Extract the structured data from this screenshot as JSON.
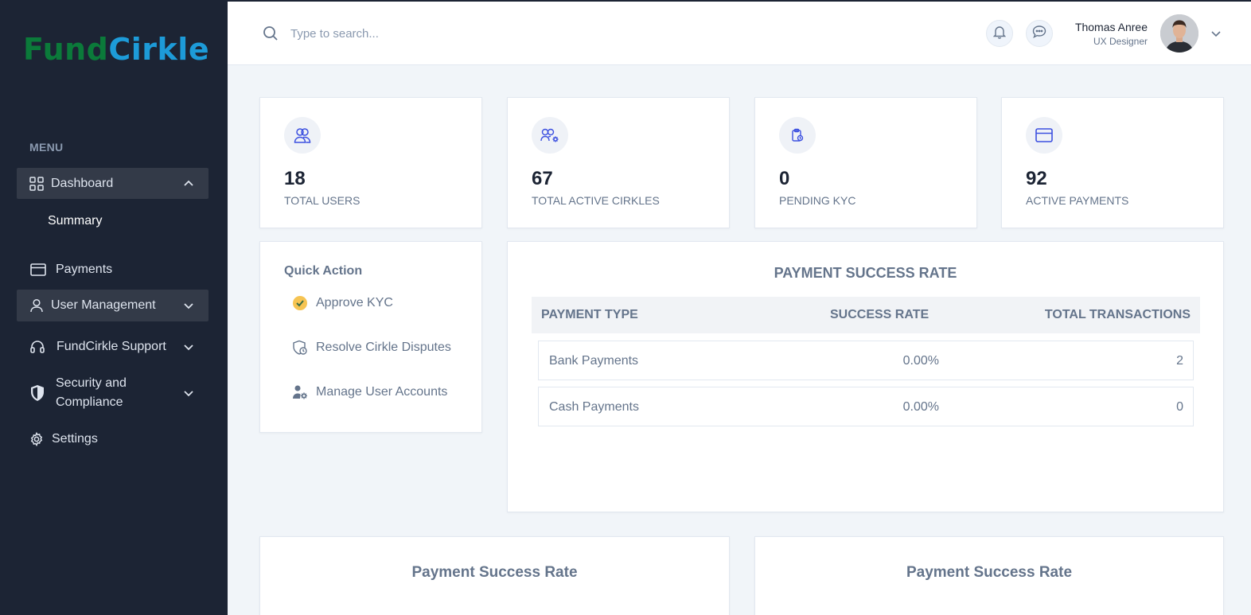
{
  "brand": {
    "part1": "Fund",
    "part2": "Cirkle",
    "color1": "#0b7a3a",
    "color2": "#1d9bd8"
  },
  "sidebar": {
    "menu_label": "MENU",
    "items": [
      {
        "label": "Dashboard",
        "icon": "grid-icon",
        "expanded": true,
        "active": true
      },
      {
        "label": "Summary",
        "sub": true
      },
      {
        "label": "Payments",
        "icon": "credit-card-icon"
      },
      {
        "label": "User Management",
        "icon": "user-icon",
        "active": true
      },
      {
        "label": "FundCirkle Support",
        "icon": "headset-icon"
      },
      {
        "label": "Security and Compliance",
        "icon": "shield-icon"
      },
      {
        "label": "Settings",
        "icon": "gear-icon"
      }
    ]
  },
  "header": {
    "search_placeholder": "Type to search...",
    "user": {
      "name": "Thomas Anree",
      "role": "UX Designer"
    }
  },
  "stats": [
    {
      "value": "18",
      "label": "TOTAL USERS",
      "icon": "users-icon"
    },
    {
      "value": "67",
      "label": "TOTAL ACTIVE CIRKLES",
      "icon": "users-gear-icon"
    },
    {
      "value": "0",
      "label": "PENDING KYC",
      "icon": "clipboard-icon"
    },
    {
      "value": "92",
      "label": "ACTIVE PAYMENTS",
      "icon": "credit-card-icon"
    }
  ],
  "quick_action": {
    "title": "Quick Action",
    "items": [
      {
        "label": "Approve KYC",
        "icon": "check-badge-icon"
      },
      {
        "label": "Resolve Cirkle Disputes",
        "icon": "shield-clock-icon"
      },
      {
        "label": "Manage User Accounts",
        "icon": "user-gear-icon"
      }
    ]
  },
  "payment_table": {
    "title": "PAYMENT SUCCESS RATE",
    "columns": [
      "PAYMENT TYPE",
      "SUCCESS RATE",
      "TOTAL TRANSACTIONS"
    ],
    "rows": [
      {
        "type": "Bank Payments",
        "rate": "0.00%",
        "total": "2"
      },
      {
        "type": "Cash Payments",
        "rate": "0.00%",
        "total": "0"
      }
    ]
  },
  "bottom_cards": [
    {
      "title": "Payment Success Rate"
    },
    {
      "title": "Payment Success Rate"
    }
  ]
}
